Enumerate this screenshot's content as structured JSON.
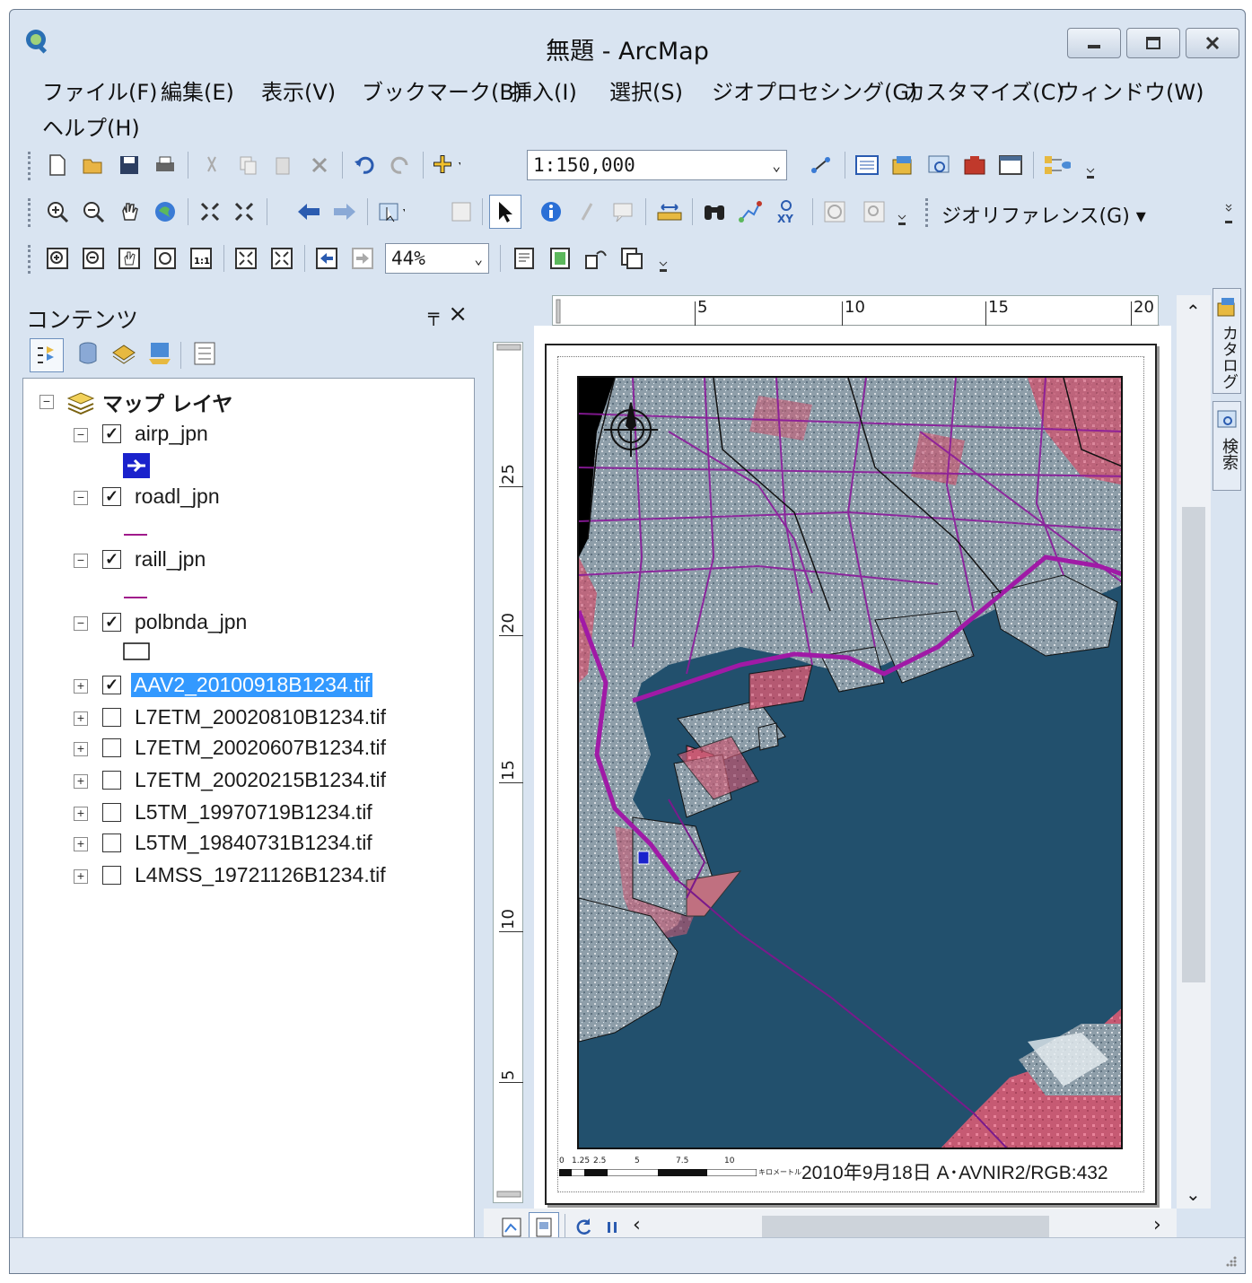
{
  "window": {
    "title": "無題 - ArcMap"
  },
  "menu": {
    "items": [
      "ファイル(F)",
      "編集(E)",
      "表示(V)",
      "ブックマーク(B)",
      "挿入(I)",
      "選択(S)",
      "ジオプロセシング(G)",
      "カスタマイズ(C)",
      "ウィンドウ(W)",
      "ヘルプ(H)"
    ]
  },
  "toolbar": {
    "scale_value": "1:150,000",
    "zoom_value": "44%",
    "georeference_label": "ジオリファレンス(G)"
  },
  "toc": {
    "title": "コンテンツ",
    "root_label": "マップ レイヤ",
    "layers": [
      {
        "name": "airp_jpn",
        "checked": true,
        "expanded": true,
        "symbol": "airport-icon"
      },
      {
        "name": "roadl_jpn",
        "checked": true,
        "expanded": true,
        "symbol": "line-symbol"
      },
      {
        "name": "raill_jpn",
        "checked": true,
        "expanded": true,
        "symbol": "line-symbol"
      },
      {
        "name": "polbnda_jpn",
        "checked": true,
        "expanded": true,
        "symbol": "polygon-symbol"
      },
      {
        "name": "AAV2_20100918B1234.tif",
        "checked": true,
        "expanded": false,
        "selected": true
      },
      {
        "name": "L7ETM_20020810B1234.tif",
        "checked": false,
        "expanded": false
      },
      {
        "name": "L7ETM_20020607B1234.tif",
        "checked": false,
        "expanded": false
      },
      {
        "name": "L7ETM_20020215B1234.tif",
        "checked": false,
        "expanded": false
      },
      {
        "name": "L5TM_19970719B1234.tif",
        "checked": false,
        "expanded": false
      },
      {
        "name": "L5TM_19840731B1234.tif",
        "checked": false,
        "expanded": false
      },
      {
        "name": "L4MSS_19721126B1234.tif",
        "checked": false,
        "expanded": false
      }
    ]
  },
  "layout": {
    "hruler_labels": [
      "5",
      "10",
      "15",
      "20"
    ],
    "vruler_labels": [
      "25",
      "20",
      "15",
      "10",
      "5"
    ],
    "scalebar_labels": [
      "0",
      "1.25",
      "2.5",
      "5",
      "7.5",
      "10"
    ],
    "scalebar_unit": "キロメートル",
    "caption": "2010年9月18日 A･AVNIR2/RGB:432"
  },
  "dock": {
    "catalog_label": "カタログ",
    "search_label": "検索"
  },
  "colors": {
    "window_bg": "#d9e4f1",
    "selection": "#3399ff",
    "sea": "#1f4e6b",
    "road": "#8b1a9b",
    "land": "#8a9aa6",
    "vegetation": "#d9506f"
  }
}
